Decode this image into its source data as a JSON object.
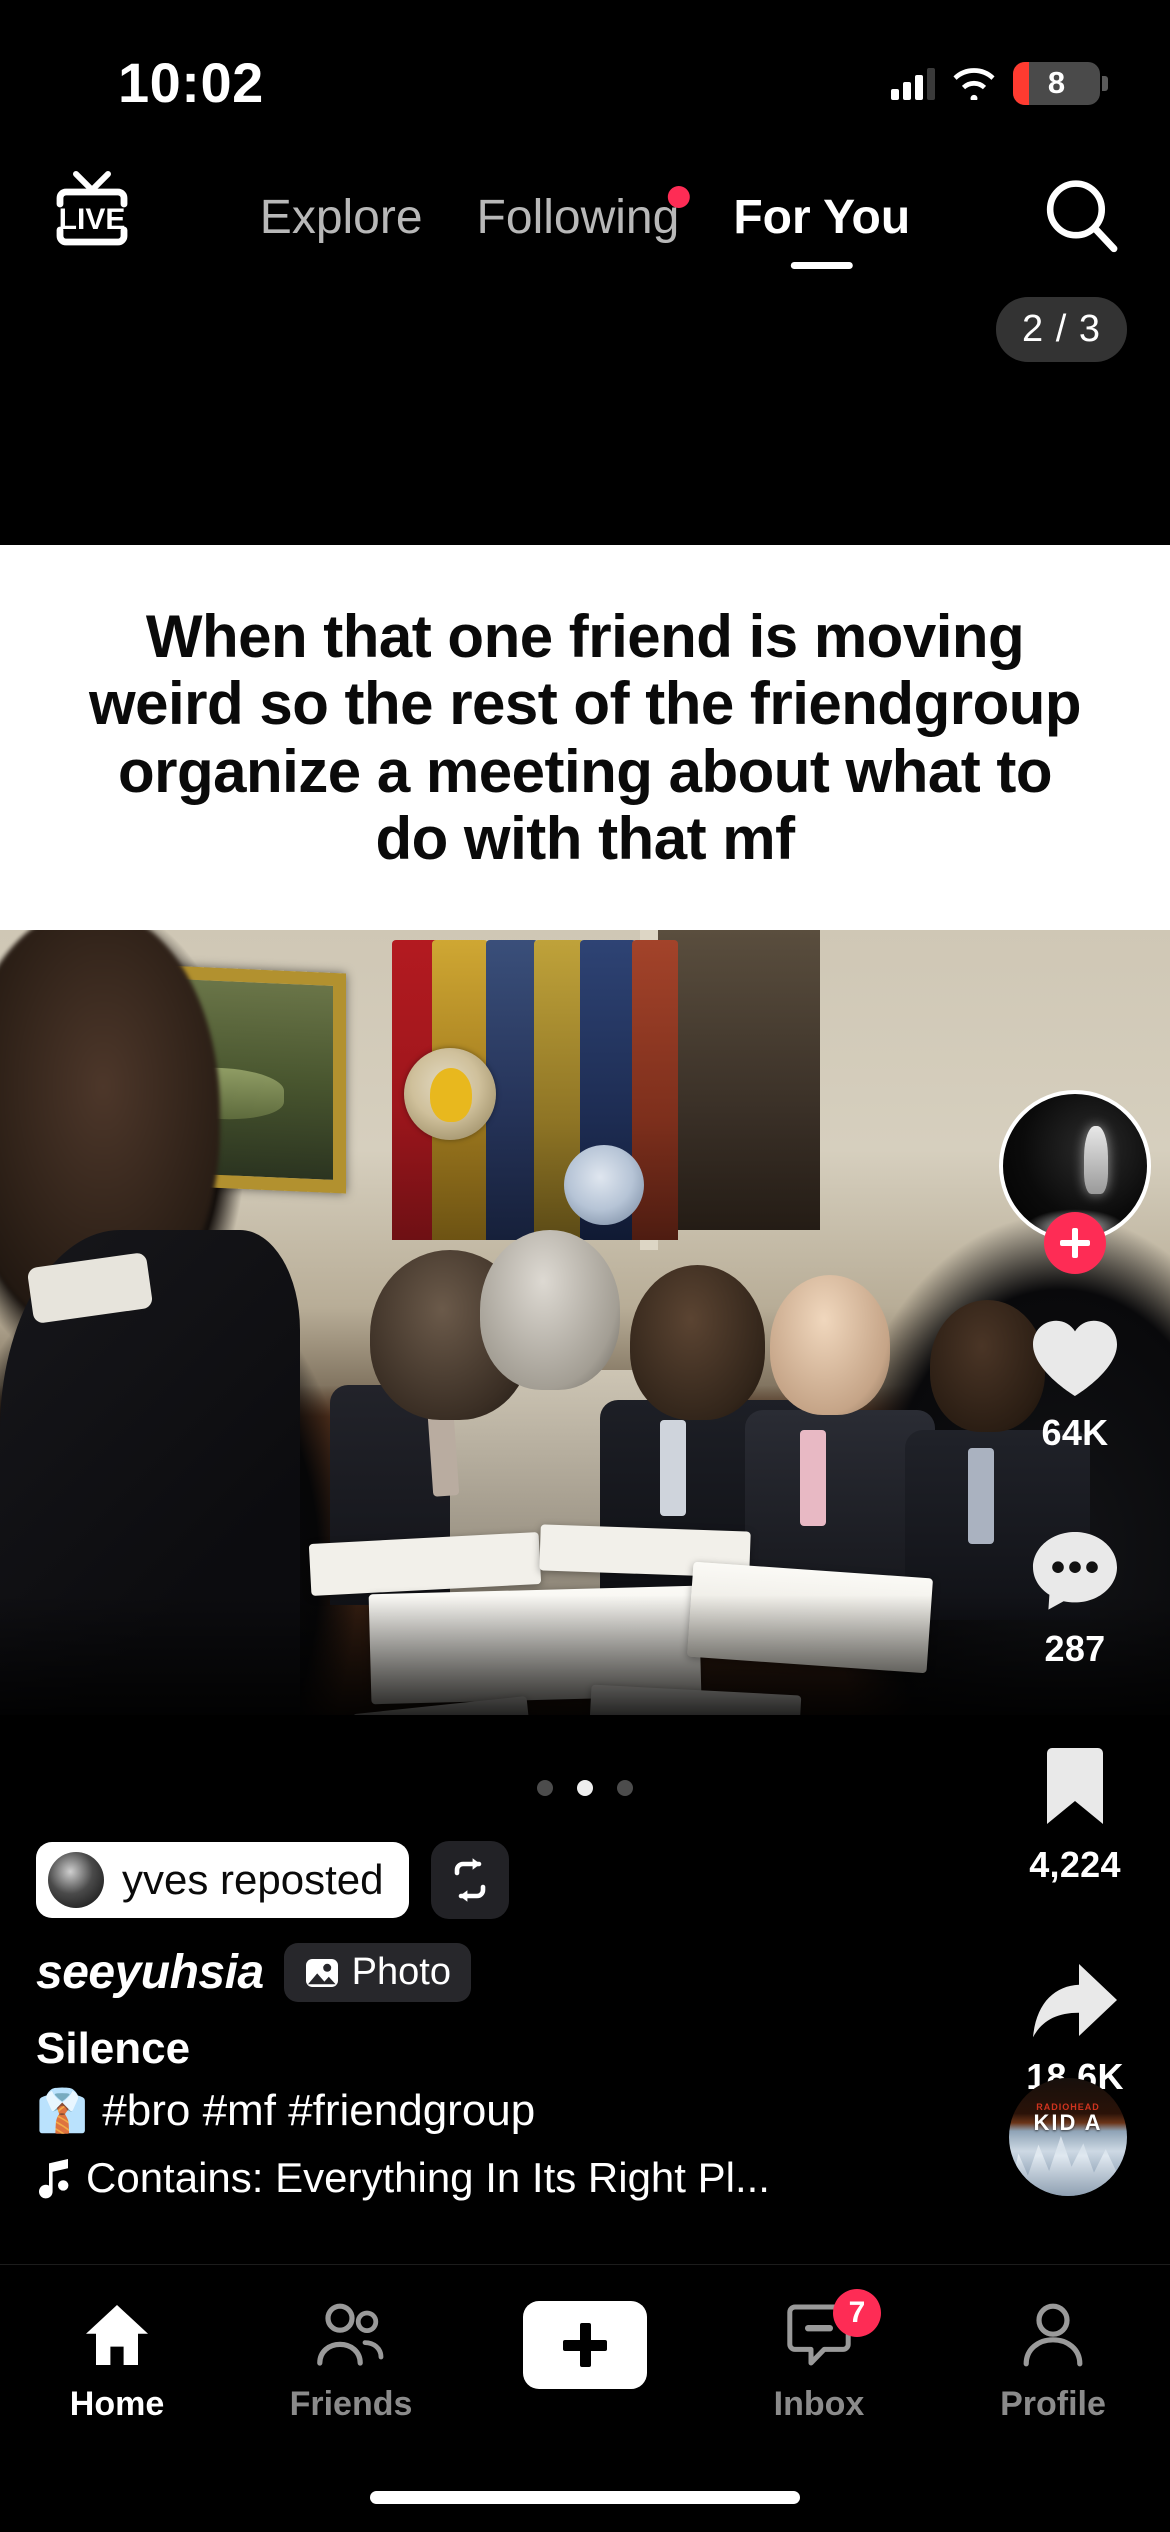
{
  "status_bar": {
    "time": "10:02",
    "battery_percent": "8",
    "signal_icon": "cellular-signal-icon",
    "wifi_icon": "wifi-icon",
    "battery_icon": "battery-icon",
    "battery_color": "#ff3b30"
  },
  "top_nav": {
    "live_label": "LIVE",
    "live_icon": "live-tv-icon",
    "search_icon": "search-icon",
    "tabs": [
      {
        "label": "Explore",
        "active": false,
        "badge": false
      },
      {
        "label": "Following",
        "active": false,
        "badge": true
      },
      {
        "label": "For You",
        "active": true,
        "badge": false
      }
    ],
    "accent_color": "#fe2c55"
  },
  "photo_counter": "2 / 3",
  "post": {
    "meme_caption": "When that one friend is moving weird so the rest of the friendgroup organize a meeting about what to do with that mf",
    "image_description": "White House meeting room with flags, framed landscape painting and officials in suits seated around a table",
    "carousel_dots": 3,
    "carousel_active_index": 1
  },
  "action_rail": {
    "avatar_name": "creator-avatar",
    "follow_label": "+",
    "actions": [
      {
        "icon": "heart-icon",
        "count": "64K",
        "name": "like-button"
      },
      {
        "icon": "comment-icon",
        "count": "287",
        "name": "comment-button"
      },
      {
        "icon": "bookmark-icon",
        "count": "4,224",
        "name": "save-button"
      },
      {
        "icon": "share-icon",
        "count": "18.6K",
        "name": "share-button"
      }
    ]
  },
  "footer": {
    "repost_text": "yves reposted",
    "repost_icon": "repost-icon",
    "username": "seeyuhsia",
    "photo_badge_label": "Photo",
    "photo_badge_icon": "image-icon",
    "description_title": "Silence",
    "hashtag_emoji": "👔",
    "hashtags": "#bro #mf #friendgroup",
    "music_icon": "music-note-icon",
    "music_text": "Contains: Everything In Its Right Pl...",
    "album_artist": "RADIOHEAD",
    "album_title": "KID A"
  },
  "tab_bar": {
    "tabs": [
      {
        "label": "Home",
        "icon": "home-icon",
        "active": true,
        "badge": ""
      },
      {
        "label": "Friends",
        "icon": "friends-icon",
        "active": false,
        "badge": ""
      },
      {
        "label": "",
        "icon": "create-plus-icon",
        "active": false,
        "badge": ""
      },
      {
        "label": "Inbox",
        "icon": "inbox-icon",
        "active": false,
        "badge": "7"
      },
      {
        "label": "Profile",
        "icon": "profile-icon",
        "active": false,
        "badge": ""
      }
    ]
  }
}
